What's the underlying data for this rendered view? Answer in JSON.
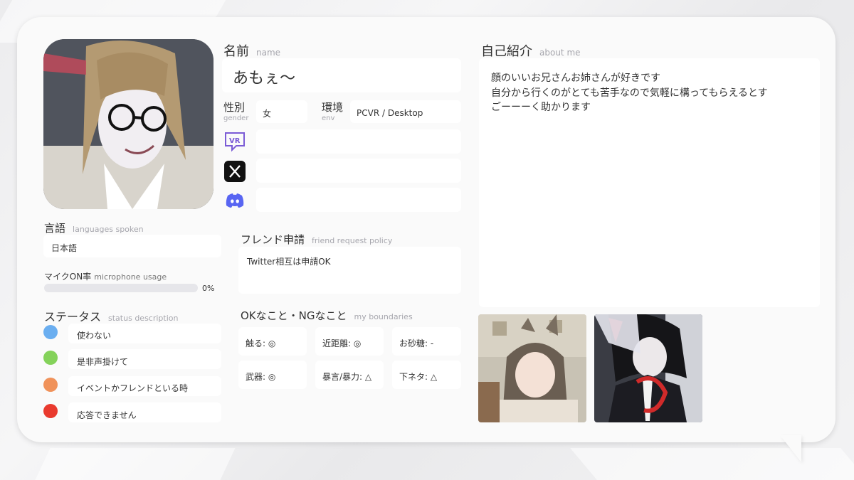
{
  "name": {
    "label": "名前",
    "label_en": "name",
    "value": "あもぇ〜"
  },
  "gender": {
    "label": "性別",
    "label_en": "gender",
    "value": "女"
  },
  "env": {
    "label": "環境",
    "label_en": "env",
    "value": "PCVR / Desktop"
  },
  "social": {
    "vrchat": "",
    "x": "",
    "discord": ""
  },
  "languages": {
    "label": "言語",
    "label_en": "languages spoken",
    "value": "日本語"
  },
  "mic": {
    "label": "マイクON率",
    "label_en": "microphone usage",
    "percent_text": "0%",
    "fraction": 0
  },
  "status": {
    "label": "ステータス",
    "label_en": "status description",
    "items": [
      {
        "color": "#6aaef0",
        "text": "使わない"
      },
      {
        "color": "#84d25a",
        "text": "是非声掛けて"
      },
      {
        "color": "#f0925a",
        "text": "イベントかフレンドといる時"
      },
      {
        "color": "#e93a2e",
        "text": "応答できません"
      }
    ]
  },
  "friend_request": {
    "label": "フレンド申請",
    "label_en": "friend request policy",
    "value": "Twitter相互は申請OK"
  },
  "boundaries": {
    "label": "OKなこと・NGなこと",
    "label_en": "my boundaries",
    "items": [
      "触る: ◎",
      "近距離: ◎",
      "お砂糖: -",
      "武器: ◎",
      "暴言/暴力: △",
      "下ネタ: △"
    ]
  },
  "about": {
    "label": "自己紹介",
    "label_en": "about me",
    "lines": [
      "顔のいいお兄さんお姉さんが好きです",
      "自分から行くのがとても苦手なので気軽に構ってもらえるとす",
      "ごーーーく助かります"
    ]
  },
  "icons": {
    "vrchat": "vrchat-icon",
    "x": "x-logo-icon",
    "discord": "discord-icon"
  },
  "colors": {
    "accent_discord": "#5865f2",
    "vrchat_purple": "#7b5cd6"
  }
}
